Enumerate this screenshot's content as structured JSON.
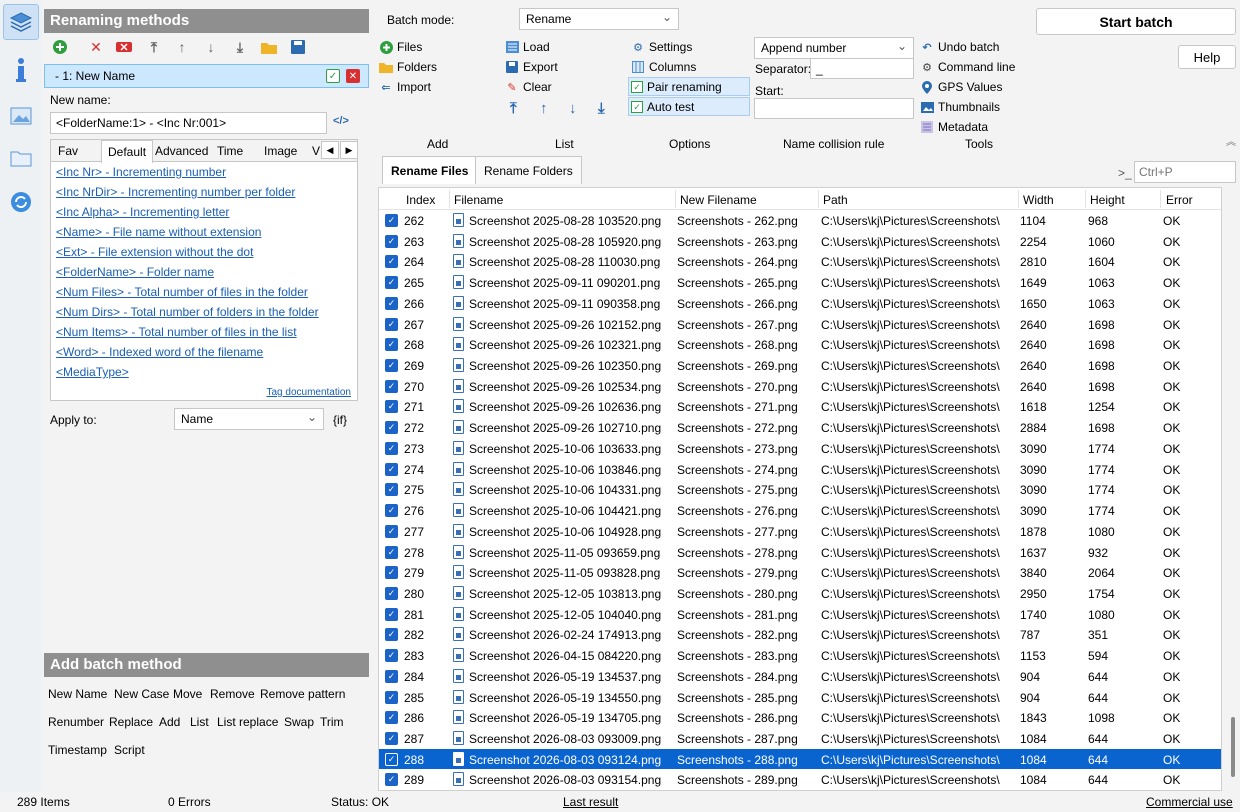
{
  "left_panel": {
    "header": "Renaming methods",
    "method_item": "-  1: New Name",
    "new_name_label": "New name:",
    "new_name_value": "<FolderName:1> - <Inc Nr:001>",
    "tabs": [
      "Fav",
      "Default",
      "Advanced",
      "Time",
      "Image",
      "V"
    ],
    "tags": [
      "<Inc Nr> - Incrementing number",
      "<Inc NrDir> - Incrementing number per folder",
      "<Inc Alpha> - Incrementing letter",
      "<Name> - File name without extension",
      "<Ext> - File extension without the dot",
      "<FolderName> - Folder name",
      "<Num Files> - Total number of files in the folder",
      "<Num Dirs> - Total number of folders in the folder",
      "<Num Items> - Total number of files in the list",
      "<Word> - Indexed word of the filename",
      "<MediaType>"
    ],
    "tag_documentation": "Tag documentation",
    "apply_to_label": "Apply to:",
    "apply_to_value": "Name",
    "if_label": "{if}",
    "add_batch_header": "Add batch method",
    "add_batch_methods_row1": [
      "New Name",
      "New Case",
      "Move",
      "Remove",
      "Remove pattern"
    ],
    "add_batch_methods_row2": [
      "Renumber",
      "Replace",
      "Add",
      "List",
      "List replace",
      "Swap",
      "Trim"
    ],
    "add_batch_methods_row3": [
      "Timestamp",
      "Script"
    ]
  },
  "toolbar": {
    "batch_mode_label": "Batch mode:",
    "batch_mode_value": "Rename",
    "start_batch": "Start batch",
    "help": "Help",
    "add_group": [
      "Files",
      "Folders",
      "Import"
    ],
    "list_group": [
      "Load",
      "Export",
      "Clear"
    ],
    "options_group": [
      "Settings",
      "Columns",
      "Pair renaming",
      "Auto test"
    ],
    "collision_value": "Append number",
    "separator_label": "Separator:",
    "separator_value": "_",
    "start_label": "Start:",
    "tools_group": [
      "Undo batch",
      "Command line",
      "GPS Values",
      "Thumbnails",
      "Metadata"
    ],
    "group_labels": [
      "Add",
      "List",
      "Options",
      "Name collision rule",
      "Tools"
    ],
    "search_placeholder": "Ctrl+P",
    "search_prompt": ">_"
  },
  "file_tabs": [
    "Rename Files",
    "Rename Folders"
  ],
  "grid": {
    "columns": [
      "Index",
      "Filename",
      "New Filename",
      "Path",
      "Width",
      "Height",
      "Error"
    ],
    "path": "C:\\Users\\kj\\Pictures\\Screenshots\\",
    "rows": [
      [
        "262",
        "Screenshot 2025-08-28 103520.png",
        "Screenshots - 262.png",
        "1104",
        "968",
        "OK"
      ],
      [
        "263",
        "Screenshot 2025-08-28 105920.png",
        "Screenshots - 263.png",
        "2254",
        "1060",
        "OK"
      ],
      [
        "264",
        "Screenshot 2025-08-28 110030.png",
        "Screenshots - 264.png",
        "2810",
        "1604",
        "OK"
      ],
      [
        "265",
        "Screenshot 2025-09-11 090201.png",
        "Screenshots - 265.png",
        "1649",
        "1063",
        "OK"
      ],
      [
        "266",
        "Screenshot 2025-09-11 090358.png",
        "Screenshots - 266.png",
        "1650",
        "1063",
        "OK"
      ],
      [
        "267",
        "Screenshot 2025-09-26 102152.png",
        "Screenshots - 267.png",
        "2640",
        "1698",
        "OK"
      ],
      [
        "268",
        "Screenshot 2025-09-26 102321.png",
        "Screenshots - 268.png",
        "2640",
        "1698",
        "OK"
      ],
      [
        "269",
        "Screenshot 2025-09-26 102350.png",
        "Screenshots - 269.png",
        "2640",
        "1698",
        "OK"
      ],
      [
        "270",
        "Screenshot 2025-09-26 102534.png",
        "Screenshots - 270.png",
        "2640",
        "1698",
        "OK"
      ],
      [
        "271",
        "Screenshot 2025-09-26 102636.png",
        "Screenshots - 271.png",
        "1618",
        "1254",
        "OK"
      ],
      [
        "272",
        "Screenshot 2025-09-26 102710.png",
        "Screenshots - 272.png",
        "2884",
        "1698",
        "OK"
      ],
      [
        "273",
        "Screenshot 2025-10-06 103633.png",
        "Screenshots - 273.png",
        "3090",
        "1774",
        "OK"
      ],
      [
        "274",
        "Screenshot 2025-10-06 103846.png",
        "Screenshots - 274.png",
        "3090",
        "1774",
        "OK"
      ],
      [
        "275",
        "Screenshot 2025-10-06 104331.png",
        "Screenshots - 275.png",
        "3090",
        "1774",
        "OK"
      ],
      [
        "276",
        "Screenshot 2025-10-06 104421.png",
        "Screenshots - 276.png",
        "3090",
        "1774",
        "OK"
      ],
      [
        "277",
        "Screenshot 2025-10-06 104928.png",
        "Screenshots - 277.png",
        "1878",
        "1080",
        "OK"
      ],
      [
        "278",
        "Screenshot 2025-11-05 093659.png",
        "Screenshots - 278.png",
        "1637",
        "932",
        "OK"
      ],
      [
        "279",
        "Screenshot 2025-11-05 093828.png",
        "Screenshots - 279.png",
        "3840",
        "2064",
        "OK"
      ],
      [
        "280",
        "Screenshot 2025-12-05 103813.png",
        "Screenshots - 280.png",
        "2950",
        "1754",
        "OK"
      ],
      [
        "281",
        "Screenshot 2025-12-05 104040.png",
        "Screenshots - 281.png",
        "1740",
        "1080",
        "OK"
      ],
      [
        "282",
        "Screenshot 2026-02-24 174913.png",
        "Screenshots - 282.png",
        "787",
        "351",
        "OK"
      ],
      [
        "283",
        "Screenshot 2026-04-15 084220.png",
        "Screenshots - 283.png",
        "1153",
        "594",
        "OK"
      ],
      [
        "284",
        "Screenshot 2026-05-19 134537.png",
        "Screenshots - 284.png",
        "904",
        "644",
        "OK"
      ],
      [
        "285",
        "Screenshot 2026-05-19 134550.png",
        "Screenshots - 285.png",
        "904",
        "644",
        "OK"
      ],
      [
        "286",
        "Screenshot 2026-05-19 134705.png",
        "Screenshots - 286.png",
        "1843",
        "1098",
        "OK"
      ],
      [
        "287",
        "Screenshot 2026-08-03 093009.png",
        "Screenshots - 287.png",
        "1084",
        "644",
        "OK"
      ],
      [
        "288",
        "Screenshot 2026-08-03 093124.png",
        "Screenshots - 288.png",
        "1084",
        "644",
        "OK"
      ],
      [
        "289",
        "Screenshot 2026-08-03 093154.png",
        "Screenshots - 289.png",
        "1084",
        "644",
        "OK"
      ]
    ],
    "selected_index": "288"
  },
  "status": {
    "items": "289 Items",
    "errors": "0 Errors",
    "status": "Status: OK",
    "last_result": "Last result",
    "commercial": "Commercial use"
  },
  "colors": {
    "accent": "#0a64d0",
    "header_gray": "#8f8f8f",
    "link": "#1a5fb4"
  }
}
